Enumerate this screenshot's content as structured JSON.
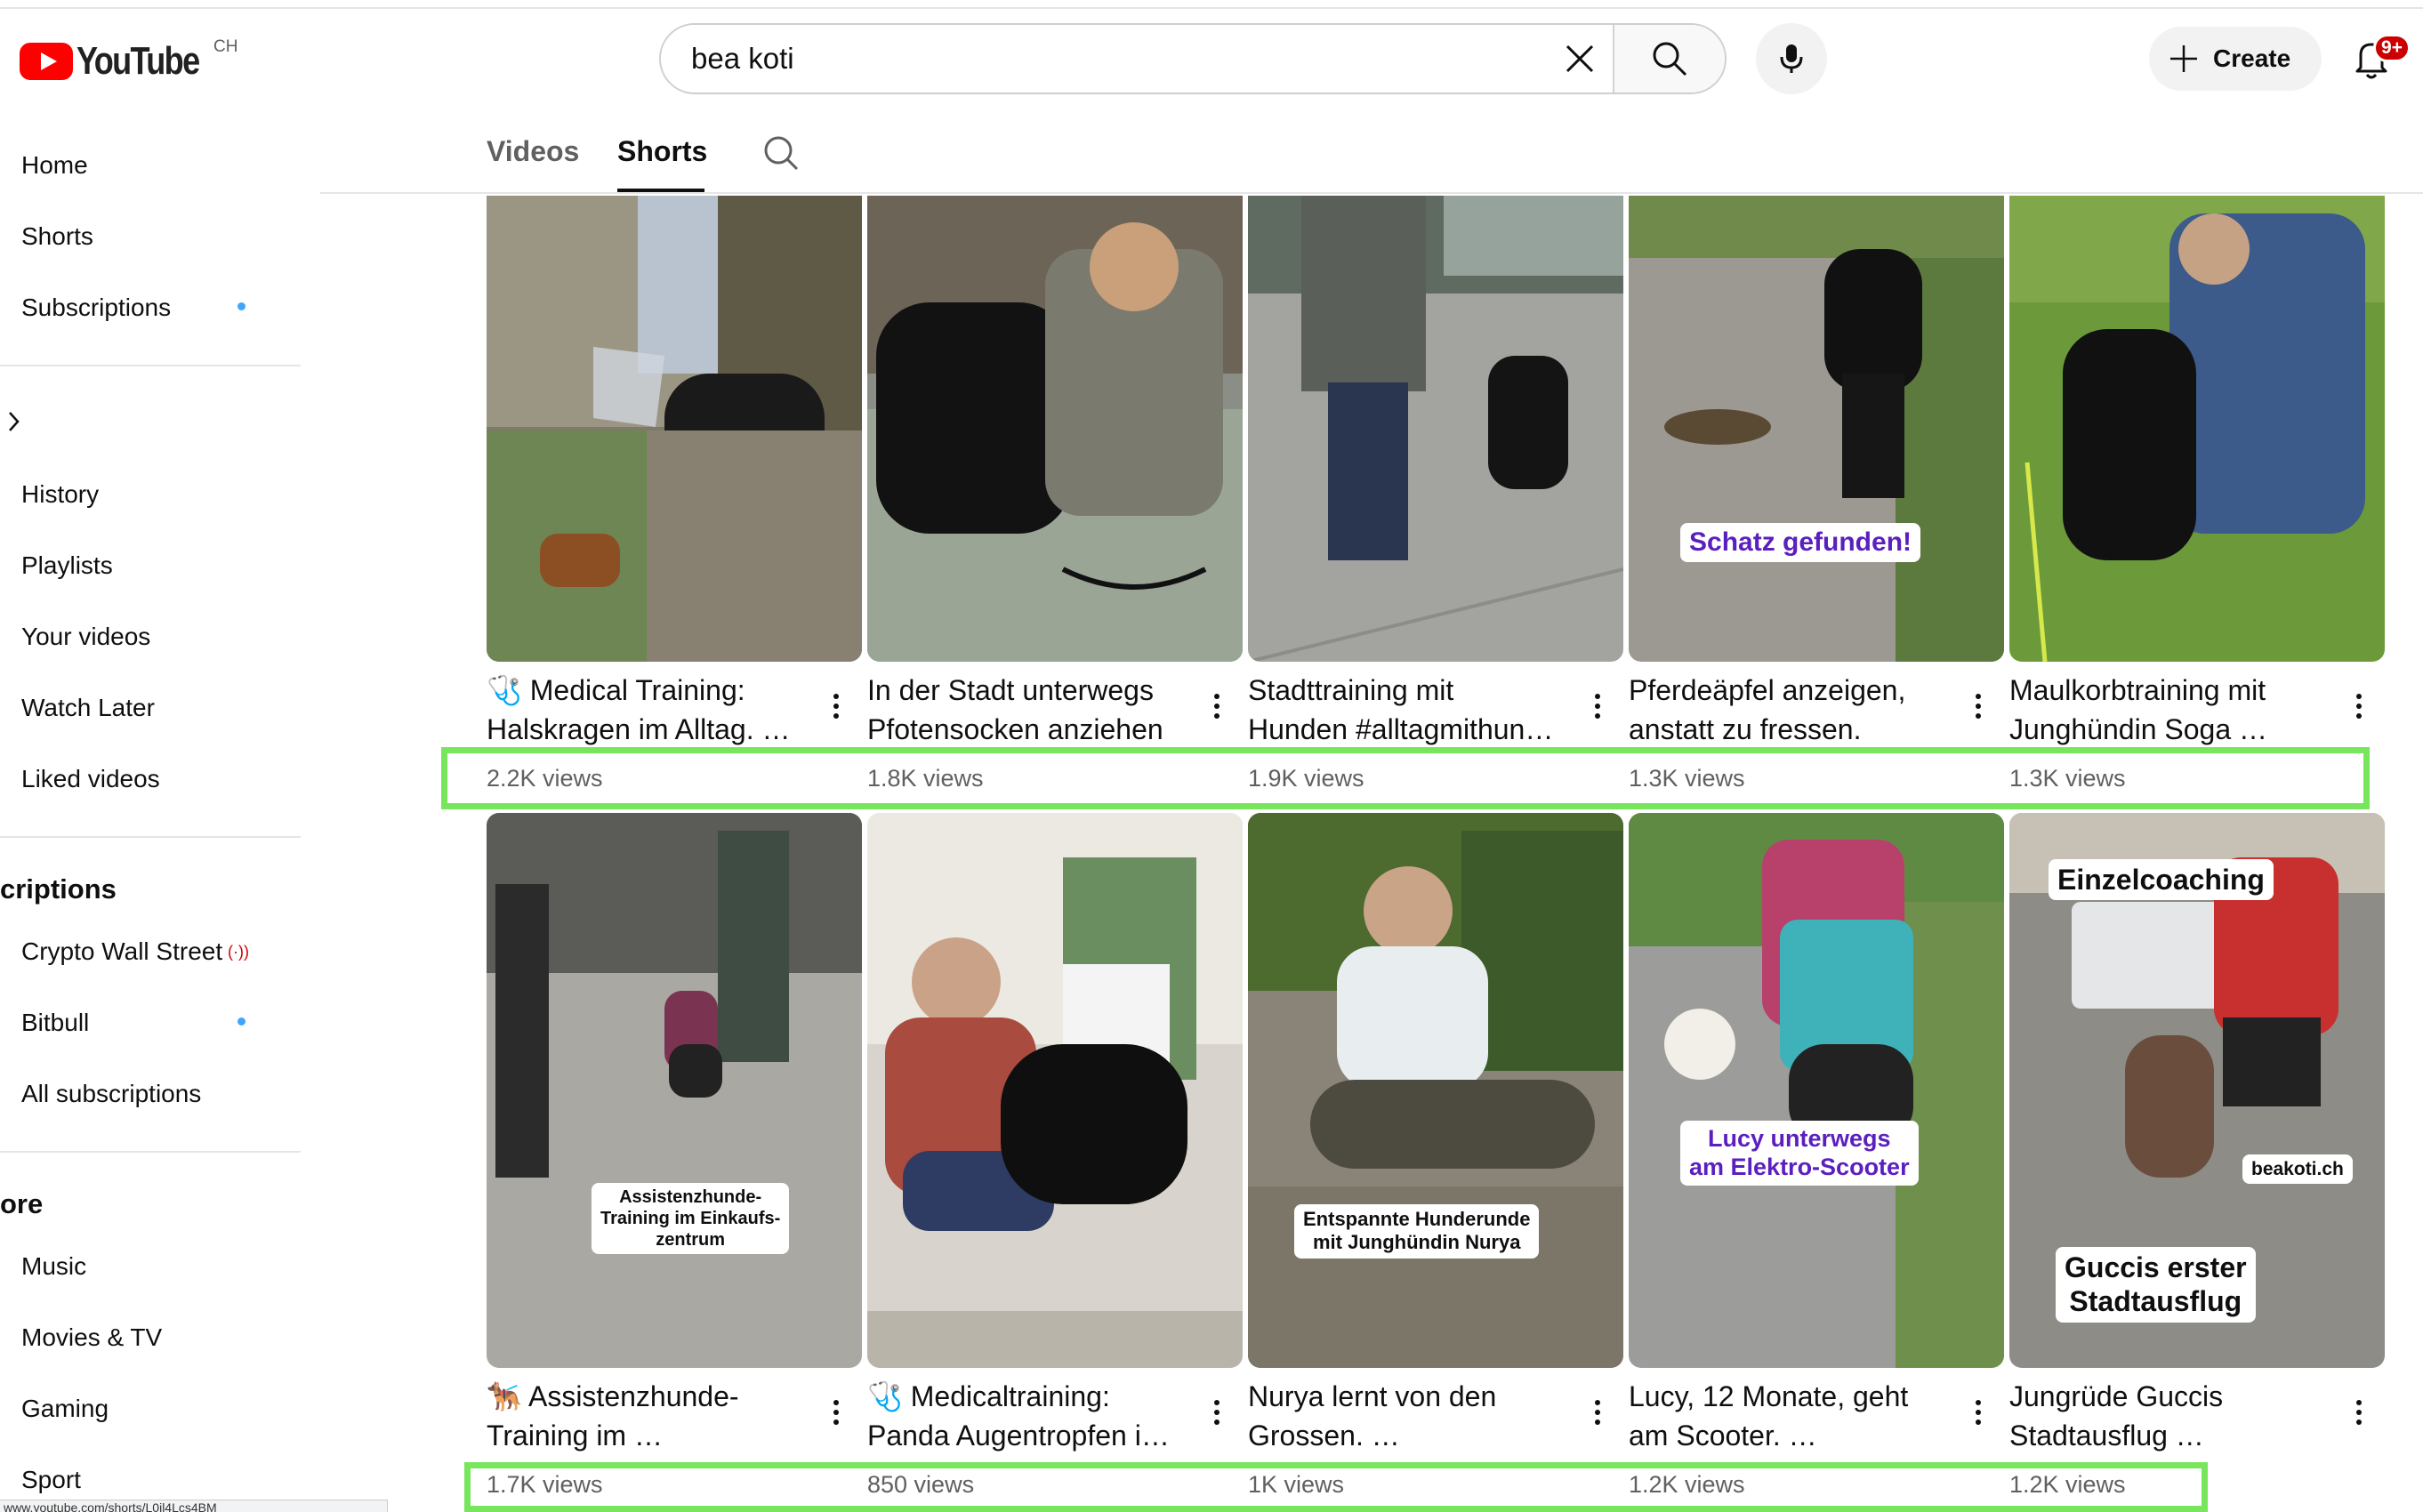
{
  "app": {
    "logo_text": "YouTube",
    "country_code": "CH"
  },
  "search": {
    "query": "bea koti"
  },
  "header": {
    "create_label": "Create",
    "notification_count": "9+"
  },
  "sidebar": {
    "main_items": [
      {
        "label": "Home"
      },
      {
        "label": "Shorts"
      },
      {
        "label": "Subscriptions"
      }
    ],
    "you_items": [
      {
        "label": "History"
      },
      {
        "label": "Playlists"
      },
      {
        "label": "Your videos"
      },
      {
        "label": "Watch Later"
      },
      {
        "label": "Liked videos"
      }
    ],
    "subscriptions_heading": "criptions",
    "subscriptions": [
      {
        "label": "Crypto Wall Street",
        "live": "(·))"
      },
      {
        "label": "Bitbull"
      },
      {
        "label": "All subscriptions"
      }
    ],
    "explore_heading": "ore",
    "explore_items": [
      {
        "label": "Music"
      },
      {
        "label": "Movies & TV"
      },
      {
        "label": "Gaming"
      },
      {
        "label": "Sport"
      }
    ]
  },
  "tabs": [
    {
      "label": "Videos",
      "active": false
    },
    {
      "label": "Shorts",
      "active": true
    }
  ],
  "shorts": [
    {
      "title1": "🩺 Medical Training:",
      "title2": "Halskragen im Alltag. …",
      "views": "2.2K views"
    },
    {
      "title1": "In der Stadt unterwegs",
      "title2": "Pfotensocken anziehen",
      "views": "1.8K views"
    },
    {
      "title1": "Stadttraining mit",
      "title2": "Hunden #alltagmithun…",
      "views": "1.9K views"
    },
    {
      "title1": "Pferdeäpfel anzeigen,",
      "title2": "anstatt zu fressen.",
      "views": "1.3K views",
      "overlay": "Schatz gefunden!"
    },
    {
      "title1": "Maulkorbtraining mit",
      "title2": "Junghündin Soga  …",
      "views": "1.3K views"
    },
    {
      "title1": "🐕‍🦺 Assistenzhunde-",
      "title2": "Training im …",
      "views": "1.7K views",
      "overlay": "Assistenzhunde-\nTraining im Einkaufs-\nzentrum"
    },
    {
      "title1": "🩺 Medicaltraining:",
      "title2": "Panda Augentropfen i…",
      "views": "850 views"
    },
    {
      "title1": "Nurya lernt von den",
      "title2": "Grossen. …",
      "views": "1K views",
      "overlay": "Entspannte Hunderunde\nmit Junghündin Nurya"
    },
    {
      "title1": "Lucy, 12 Monate, geht",
      "title2": "am Scooter.  …",
      "views": "1.2K views",
      "overlay": "Lucy unterwegs\nam Elektro-Scooter"
    },
    {
      "title1": "Jungrüde Guccis",
      "title2": "Stadtausflug  …",
      "views": "1.2K views",
      "overlay": "Guccis erster\nStadtausflug",
      "overlay_top": "Einzelcoaching",
      "overlay_side": "beakoti.ch"
    }
  ],
  "status_url": "www.youtube.com/shorts/L0jl4Lcs4BM"
}
